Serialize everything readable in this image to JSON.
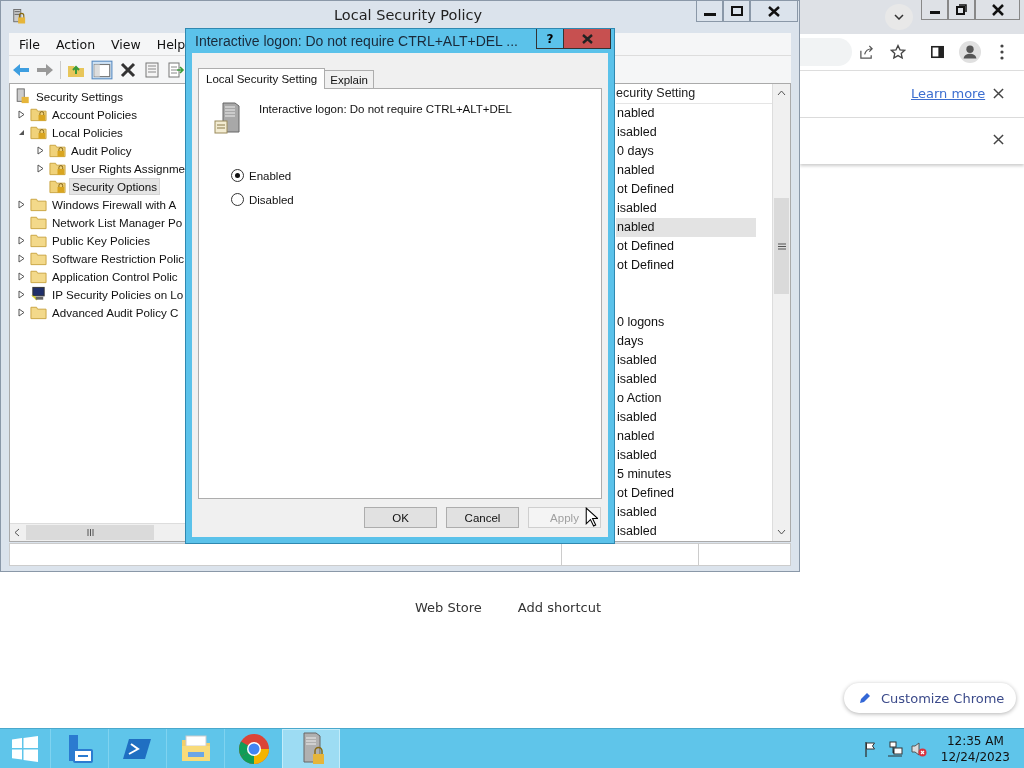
{
  "chrome_page": {
    "learn_more": "Learn more",
    "shortcuts": [
      "Web Store",
      "Add shortcut"
    ],
    "customize": "Customize Chrome"
  },
  "lsp_window": {
    "title": "Local Security Policy",
    "menu": [
      "File",
      "Action",
      "View",
      "Help"
    ],
    "tree": [
      {
        "label": "Security Settings",
        "kind": "root",
        "selected": false,
        "children": [
          {
            "label": "Account Policies",
            "kind": "lock-folder",
            "expanded": false,
            "selected": false
          },
          {
            "label": "Local Policies",
            "kind": "lock-folder",
            "expanded": true,
            "selected": false,
            "children": [
              {
                "label": "Audit Policy",
                "kind": "lock-folder",
                "expanded": false,
                "selected": false
              },
              {
                "label": "User Rights Assignme",
                "kind": "lock-folder",
                "expanded": false,
                "selected": false
              },
              {
                "label": "Security Options",
                "kind": "lock-folder",
                "selected": true
              }
            ]
          },
          {
            "label": "Windows Firewall with A",
            "kind": "folder",
            "expanded": false,
            "selected": false
          },
          {
            "label": "Network List Manager Po",
            "kind": "folder",
            "selected": false
          },
          {
            "label": "Public Key Policies",
            "kind": "folder",
            "expanded": false,
            "selected": false
          },
          {
            "label": "Software Restriction Polic",
            "kind": "folder",
            "expanded": false,
            "selected": false
          },
          {
            "label": "Application Control Polic",
            "kind": "folder",
            "expanded": false,
            "selected": false
          },
          {
            "label": "IP Security Policies on Lo",
            "kind": "network",
            "expanded": false,
            "selected": false
          },
          {
            "label": "Advanced Audit Policy C",
            "kind": "folder",
            "expanded": false,
            "selected": false
          }
        ]
      }
    ],
    "list_header": "ecurity Setting",
    "row_groups": [
      [
        {
          "text": "nabled",
          "selected": false
        },
        {
          "text": "isabled",
          "selected": false
        },
        {
          "text": "0 days",
          "selected": false
        },
        {
          "text": "nabled",
          "selected": false
        },
        {
          "text": "ot Defined",
          "selected": false
        },
        {
          "text": "isabled",
          "selected": false
        },
        {
          "text": "nabled",
          "selected": true
        },
        {
          "text": "ot Defined",
          "selected": false
        },
        {
          "text": "ot Defined",
          "selected": false
        }
      ],
      [
        {
          "text": "0 logons",
          "selected": false
        },
        {
          "text": "days",
          "selected": false
        },
        {
          "text": "isabled",
          "selected": false
        },
        {
          "text": "isabled",
          "selected": false
        },
        {
          "text": "o Action",
          "selected": false
        },
        {
          "text": "isabled",
          "selected": false
        },
        {
          "text": "nabled",
          "selected": false
        },
        {
          "text": "isabled",
          "selected": false
        },
        {
          "text": "5 minutes",
          "selected": false
        },
        {
          "text": "ot Defined",
          "selected": false
        },
        {
          "text": "isabled",
          "selected": false
        },
        {
          "text": "isabled",
          "selected": false
        }
      ]
    ]
  },
  "dialog": {
    "title": "Interactive logon: Do not require CTRL+ALT+DEL ...",
    "help": "?",
    "tabs": [
      {
        "label": "Local Security Setting",
        "selected": true
      },
      {
        "label": "Explain",
        "selected": false
      }
    ],
    "policy": "Interactive logon: Do not require CTRL+ALT+DEL",
    "options": [
      {
        "label": "Enabled",
        "selected": true
      },
      {
        "label": "Disabled",
        "selected": false
      }
    ],
    "buttons": [
      {
        "label": "OK",
        "disabled": false
      },
      {
        "label": "Cancel",
        "disabled": false
      },
      {
        "label": "Apply",
        "disabled": true
      }
    ]
  },
  "taskbar": {
    "apps": [
      {
        "kind": "server",
        "selected": false
      },
      {
        "kind": "powershell",
        "selected": false
      },
      {
        "kind": "explorer",
        "selected": false
      },
      {
        "kind": "chrome",
        "selected": false
      },
      {
        "kind": "policy",
        "selected": true
      }
    ],
    "time": "12:35 AM",
    "date": "12/24/2023"
  }
}
